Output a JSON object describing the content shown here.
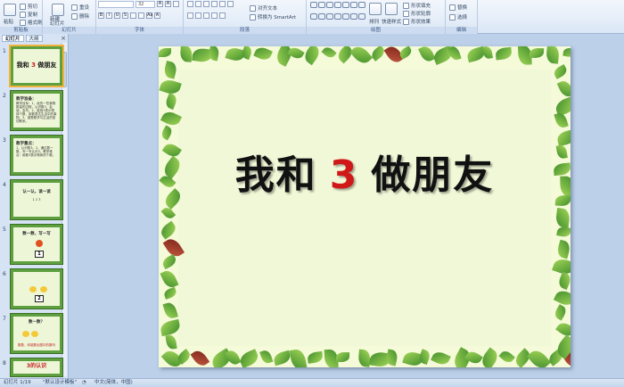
{
  "ribbon": {
    "clipboard": {
      "paste": "粘贴",
      "cut": "剪切",
      "copy": "复制",
      "format_painter": "格式刷",
      "label": "剪贴板"
    },
    "slides": {
      "new_slide": "新建\n幻灯片",
      "reset": "重设",
      "delete": "删除",
      "label": "幻灯片"
    },
    "font": {
      "size": "32",
      "label": "字体"
    },
    "paragraph": {
      "align_text": "对齐文本",
      "smartart": "转换为 SmartArt",
      "label": "段落"
    },
    "drawing": {
      "arrange": "排列",
      "quick_styles": "快速样式",
      "shape_fill": "形状填充",
      "shape_outline": "形状轮廓",
      "shape_effects": "形状效果",
      "label": "绘图"
    },
    "editing": {
      "replace": "替换",
      "select": "选择",
      "label": "编辑"
    }
  },
  "panel": {
    "tabs": [
      "幻灯片",
      "大纲"
    ],
    "close": "×"
  },
  "thumbnails": [
    {
      "num": "1",
      "title_a": "我和",
      "title_num": "3",
      "title_b": "做朋友"
    },
    {
      "num": "2",
      "text_head": "教学准备：",
      "text_body": "教学目标：1、经历一些事物数量的过程，认识数3，会读，会写。2、能用3表示物体个数，用数表达生活中的事物。3、感受数学与生活的密切联系。"
    },
    {
      "num": "3",
      "text_head": "教学重点：",
      "text_body": "1、认识数3。2、通过数一数、写一写认识3。教学难点：用数3表示物体的个数。"
    },
    {
      "num": "4",
      "text_head": "认一认，读一读",
      "text_body": "1  2  3"
    },
    {
      "num": "5",
      "text_head": "数一数，写一写",
      "box": "1"
    },
    {
      "num": "6",
      "box": "2"
    },
    {
      "num": "7",
      "text_head": "数一数？",
      "text_body": "数数，你能数出图中的数吗"
    },
    {
      "num": "8",
      "text_head": "3的认识"
    }
  ],
  "slide": {
    "title_a": "我和",
    "title_num": "3",
    "title_b": "做朋友"
  },
  "status": {
    "slide_info": "幻灯片 1/19",
    "theme": "\"默认设计模板\"",
    "language": "中文(简体，中国)"
  },
  "colors": {
    "accent_red": "#d01818",
    "leaf_green": "#3e8c2a",
    "slide_bg": "#f1f8d7"
  }
}
